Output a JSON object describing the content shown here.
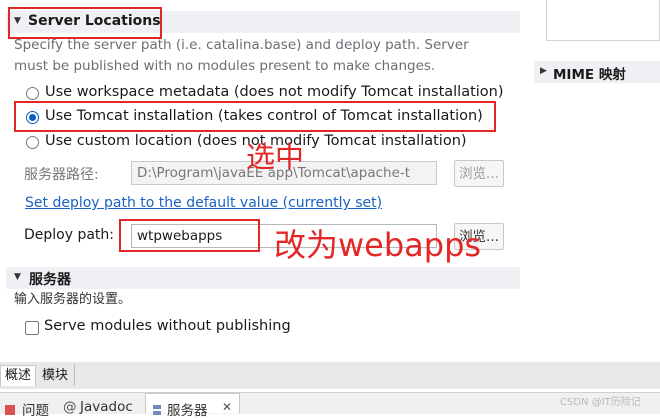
{
  "server_locations": {
    "title": "Server Locations",
    "description_line1": "Specify the server path (i.e. catalina.base) and deploy path. Server",
    "description_line2": "must be published with no modules present to make changes.",
    "options": [
      {
        "label": "Use workspace metadata (does not modify Tomcat installation)",
        "selected": false
      },
      {
        "label": "Use Tomcat installation (takes control of Tomcat installation)",
        "selected": true
      },
      {
        "label": "Use custom location (does not modify Tomcat installation)",
        "selected": false
      }
    ],
    "server_path_label": "服务器路径:",
    "server_path_value": "D:\\Program\\javaEE app\\Tomcat\\apache-t",
    "browse_label": "浏览...",
    "default_link": "Set deploy path to the default value (currently set)",
    "deploy_path_label": "Deploy path:",
    "deploy_path_value": "wtpwebapps",
    "deploy_browse_label": "浏览..."
  },
  "server_section": {
    "title": "服务器",
    "description": "输入服务器的设置。",
    "checkbox_label": "Serve modules without publishing",
    "checked": false
  },
  "right_panel": {
    "mime_title": "MIME 映射"
  },
  "annotations": {
    "select": "选中",
    "change": "改为webapps"
  },
  "editor_tabs": [
    {
      "label": "概述",
      "active": true
    },
    {
      "label": "模块",
      "active": false
    }
  ],
  "view_tabs": [
    {
      "icon": "problems-icon",
      "label": "问题"
    },
    {
      "icon": "at-icon",
      "label": "Javadoc"
    },
    {
      "icon": "servers-icon",
      "label": "服务器"
    }
  ],
  "watermark": "CSDN @IT历险记",
  "colors": {
    "accent": "#0a5fb8",
    "link": "#1a62c4",
    "annotation": "#e32626"
  }
}
